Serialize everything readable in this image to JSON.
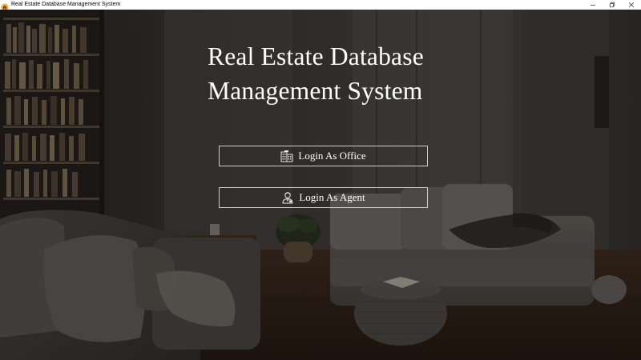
{
  "window": {
    "title": "Real Estate Database Management System",
    "app_icon": "house-icon",
    "controls": [
      "minimize-icon",
      "restore-icon",
      "close-icon"
    ]
  },
  "main": {
    "heading_line1": "Real Estate Database",
    "heading_line2": "Management System",
    "buttons": [
      {
        "label": "Login As Office",
        "icon": "office-building-icon"
      },
      {
        "label": "Login As Agent",
        "icon": "agent-person-icon"
      }
    ]
  },
  "colors": {
    "text": "#ffffff",
    "button_border": "#cfcfcf",
    "titlebar": "#ffffff"
  }
}
